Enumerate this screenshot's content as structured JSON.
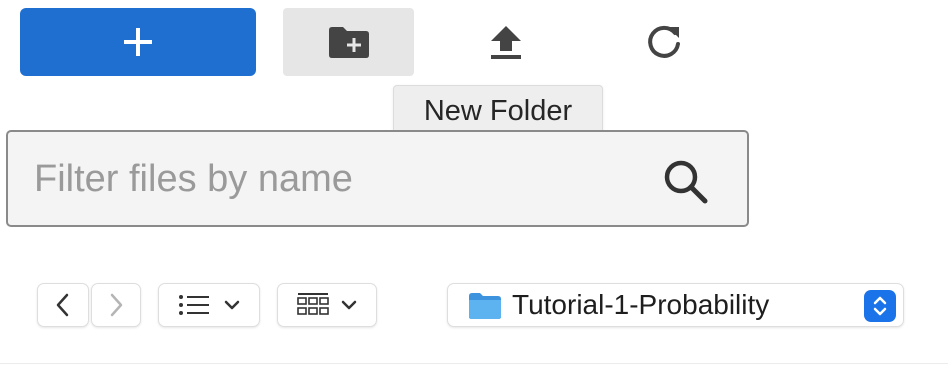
{
  "toolbar": {
    "new_button": {
      "icon": "plus-icon",
      "color": "#1f6fd1"
    },
    "new_folder_button": {
      "icon": "folder-plus-icon",
      "tooltip": "New Folder"
    },
    "upload_button": {
      "icon": "upload-icon"
    },
    "refresh_button": {
      "icon": "refresh-icon"
    }
  },
  "filter": {
    "placeholder": "Filter files by name",
    "value": "",
    "icon": "search-icon"
  },
  "navigation": {
    "back": {
      "icon": "chevron-left-icon"
    },
    "forward": {
      "icon": "chevron-right-icon"
    },
    "list_view": {
      "icon": "list-icon",
      "dropdown": "chevron-down-icon"
    },
    "grid_view": {
      "icon": "grid-icon",
      "dropdown": "chevron-down-icon"
    },
    "path": {
      "label": "Tutorial-1-Probability",
      "icon": "folder-icon",
      "folder_color": "#4aa3e8",
      "stepper_color": "#1a73e8"
    }
  }
}
